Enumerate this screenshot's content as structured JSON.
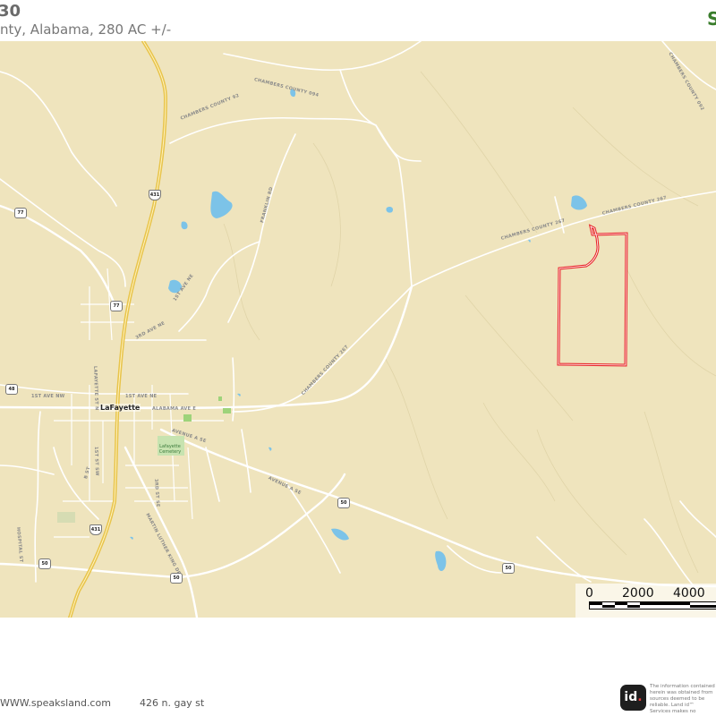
{
  "header": {
    "title_fragment": "30",
    "subtitle": "nty, Alabama, 280 AC +/-"
  },
  "map": {
    "roads": {
      "chambers_094": "CHAMBERS COUNTY 094",
      "chambers_92": "CHAMBERS COUNTY 92",
      "chambers_267_a": "CHAMBERS COUNTY 267",
      "chambers_267_b": "CHAMBERS COUNTY 267",
      "chambers_267_c": "CHAMBERS COUNTY 267",
      "chambers_092": "CHAMBERS COUNTY 092",
      "franklin_rd": "FRANKLIN RD",
      "first_ave_ne_upper": "1ST AVE NE",
      "third_ave_ne": "3RD AVE NE",
      "lafayette_st_n": "LAFAYETTE ST N",
      "first_ave_nw": "1ST AVE NW",
      "first_ave_ne": "1ST AVE NE",
      "alabama_ave_e": "ALABAMA AVE E",
      "avenue_a_se_1": "AVENUE A SE",
      "avenue_a_se_2": "AVENUE A SE",
      "first_st_sw": "1ST ST SW",
      "b_st": "B ST",
      "third_st_se": "3RD ST SE",
      "mlk_dr": "MARTIN LUTHER KING DR",
      "hospital_st": "HOSPITAL ST"
    },
    "town": "LaFayette",
    "cemetery": "Lafayette Cemetery",
    "shields": {
      "r77_top": "77",
      "r431_top": "431",
      "r77_mid": "77",
      "r48": "48",
      "r50_a": "50",
      "r431_bottom": "431",
      "r50_b": "50",
      "r50_c": "50",
      "r50_d": "50"
    },
    "scale": {
      "label_0": "0",
      "label_2000": "2000",
      "label_4000": "4000"
    },
    "colors": {
      "land": "#efe4bd",
      "water": "#7cc3e8",
      "boundary": "#e8282b",
      "highway": "#e8c44a"
    }
  },
  "footer": {
    "url": "WWW.speaksland.com",
    "address": "426 n. gay st",
    "logo_text": "id",
    "disclaimer": "The information contained herein was obtained from sources deemed to be reliable. Land id™ Services makes no warranties or guarantees as to the completeness"
  }
}
